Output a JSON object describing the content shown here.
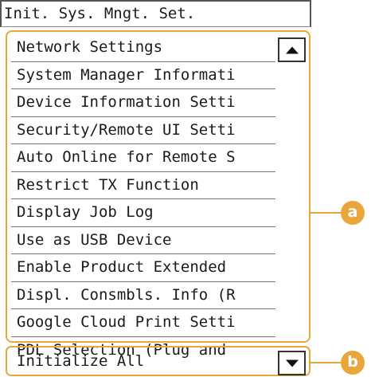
{
  "header": {
    "title": "Init. Sys. Mngt. Set."
  },
  "menu": {
    "items": [
      {
        "label": "Network Settings"
      },
      {
        "label": "System Manager Informati"
      },
      {
        "label": "Device Information Setti"
      },
      {
        "label": "Security/Remote UI Setti"
      },
      {
        "label": "Auto Online for Remote S"
      },
      {
        "label": "Restrict TX Function"
      },
      {
        "label": "Display Job Log"
      },
      {
        "label": "Use as USB Device"
      },
      {
        "label": "Enable Product Extended"
      },
      {
        "label": "Displ. Consmbls. Info (R"
      },
      {
        "label": "Google Cloud Print Setti"
      },
      {
        "label": "PDL Selection (Plug and"
      }
    ],
    "bottom_item": "Initialize All"
  },
  "scroll": {
    "up_icon": "triangle-up-icon",
    "down_icon": "triangle-down-icon"
  },
  "callouts": {
    "a": "a",
    "b": "b"
  },
  "colors": {
    "callout": "#e9a63a",
    "text": "#1a1a1a",
    "border": "#555555"
  }
}
